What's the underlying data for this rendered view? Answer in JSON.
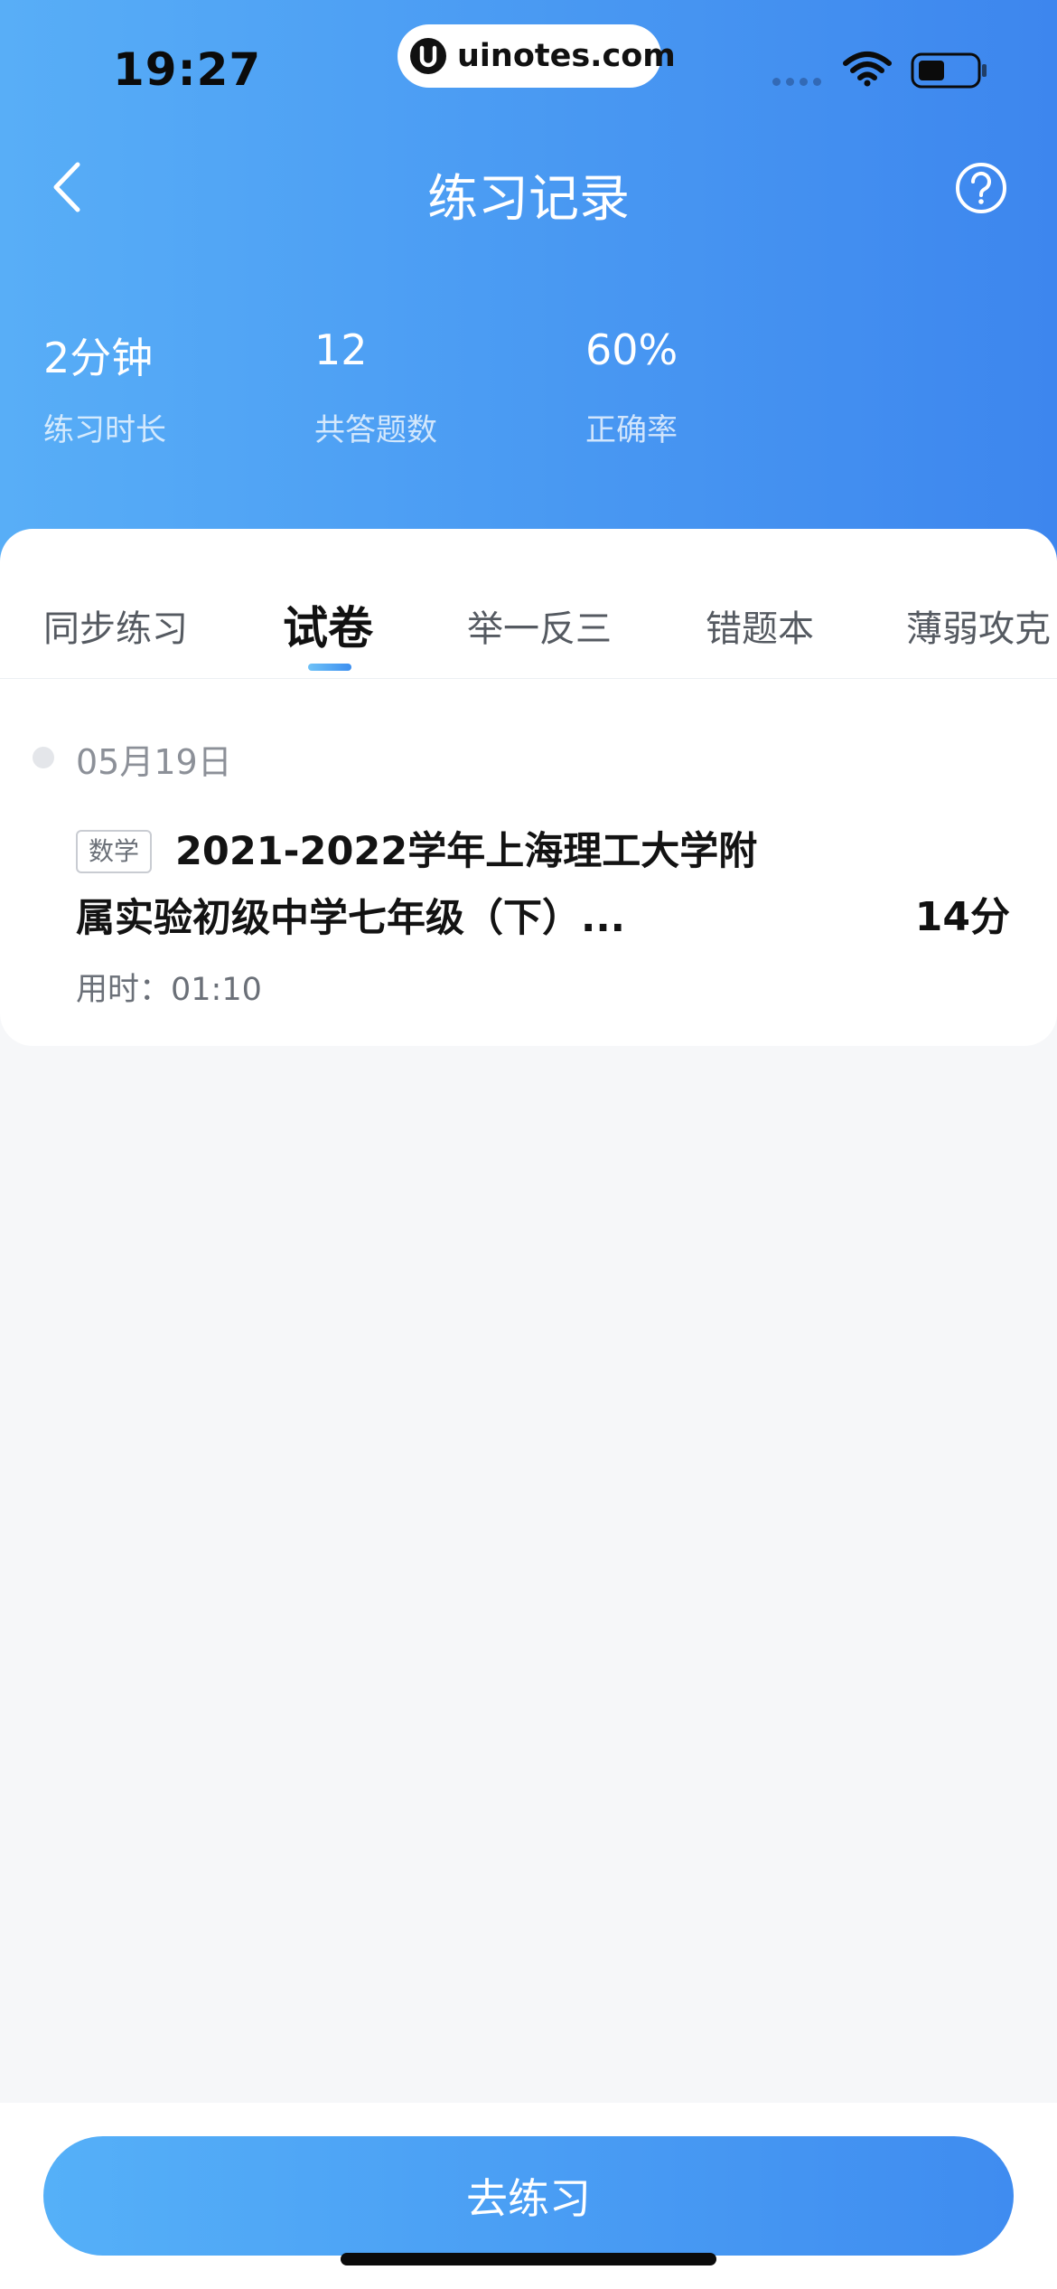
{
  "status_bar": {
    "time": "19:27",
    "url": "uinotes.com"
  },
  "nav": {
    "title": "练习记录"
  },
  "stats": [
    {
      "value": "2分钟",
      "label": "练习时长"
    },
    {
      "value": "12",
      "label": "共答题数"
    },
    {
      "value": "60%",
      "label": "正确率"
    }
  ],
  "tabs": [
    {
      "label": "同步练习",
      "active": false
    },
    {
      "label": "试卷",
      "active": true
    },
    {
      "label": "举一反三",
      "active": false
    },
    {
      "label": "错题本",
      "active": false
    },
    {
      "label": "薄弱攻克",
      "active": false
    }
  ],
  "record": {
    "date": "05月19日",
    "subject": "数学",
    "title": "2021-2022学年上海理工大学附属实验初级中学七年级（下）...",
    "score": "14分",
    "duration": "用时：01:10"
  },
  "bottom": {
    "button_label": "去练习"
  },
  "colors": {
    "header_gradient_start": "#58aef7",
    "header_gradient_end": "#3d86ee",
    "button_gradient_start": "#55b0f8",
    "button_gradient_end": "#3f8cf0"
  }
}
